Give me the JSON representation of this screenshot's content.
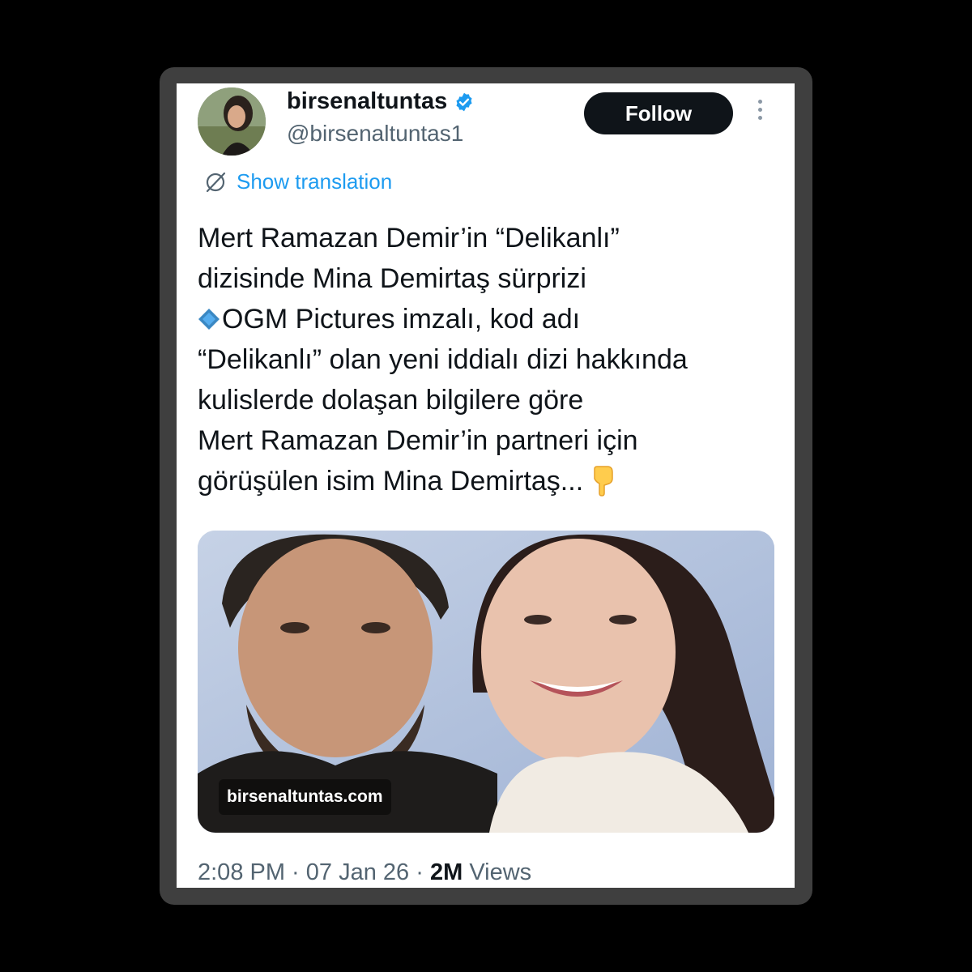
{
  "user": {
    "display_name": "birsenaltuntas",
    "handle": "@birsenaltuntas1",
    "verified_color": "#1d9bf0"
  },
  "follow_label": "Follow",
  "translation_label": "Show translation",
  "tweet": {
    "line1": "Mert Ramazan Demir’in “Delikanlı”",
    "line2": "dizisinde Mina Demirtaş sürprizi",
    "line3": "OGM Pictures imzalı, kod adı",
    "line4": "“Delikanlı” olan yeni iddialı dizi hakkında",
    "line5": "kulislerde dolaşan bilgilere göre",
    "line6": "Mert Ramazan Demir’in partneri için",
    "line7": "görüşülen isim Mina Demirtaş..."
  },
  "media": {
    "watermark": "birsenaltuntas.com"
  },
  "meta": {
    "time": "2:08 PM",
    "separator": " · ",
    "date": "07 Jan 26",
    "views_count": "2M",
    "views_label": "Views"
  },
  "icons": [
    "verified-badge-icon",
    "more-options-icon",
    "translate-icon",
    "blue-diamond-emoji-icon",
    "pointing-down-emoji-icon"
  ]
}
